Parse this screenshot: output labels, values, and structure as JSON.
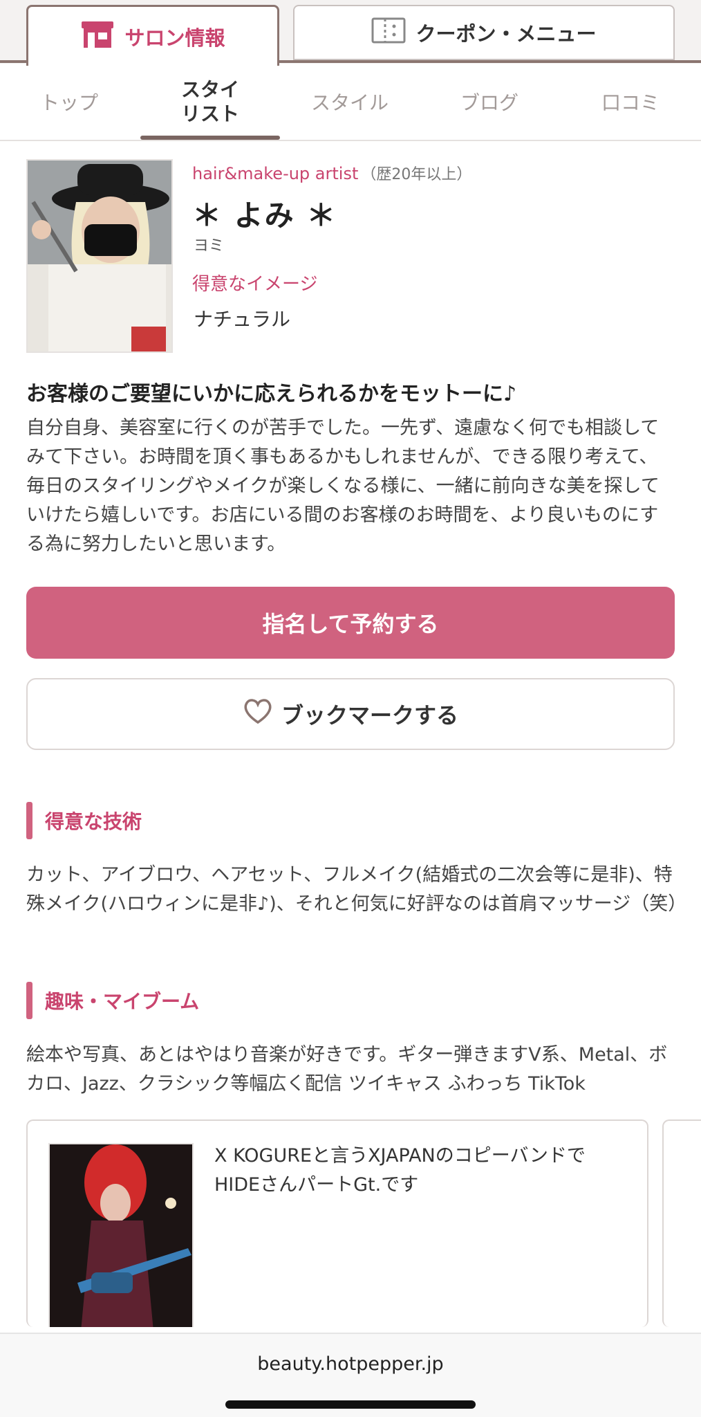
{
  "main_tabs": {
    "salon": "サロン情報",
    "coupon": "クーポン・メニュー"
  },
  "subnav": {
    "top": "トップ",
    "stylist_line1": "スタイ",
    "stylist_line2": "リスト",
    "style": "スタイル",
    "blog": "ブログ",
    "reviews": "口コミ"
  },
  "profile": {
    "role": "hair&make-up artist",
    "experience": "（歴20年以上）",
    "name": "＊ よみ ＊",
    "kana": "ヨミ",
    "image_label": "得意なイメージ",
    "image_value": "ナチュラル"
  },
  "motto": "お客様のご要望にいかに応えられるかをモットーに♪",
  "intro": "自分自身、美容室に行くのが苦手でした。一先ず、遠慮なく何でも相談してみて下さい。お時間を頂く事もあるかもしれませんが、できる限り考えて、毎日のスタイリングやメイクが楽しくなる様に、一緒に前向きな美を探していけたら嬉しいです。お店にいる間のお客様のお時間を、より良いものにする為に努力したいと思います。",
  "buttons": {
    "reserve": "指名して予約する",
    "bookmark": "ブックマークする"
  },
  "skills": {
    "heading": "得意な技術",
    "text": "カット、アイブロウ、ヘアセット、フルメイク(結婚式の二次会等に是非)、特殊メイク(ハロウィンに是非♪)、それと何気に好評なのは首肩マッサージ（笑）"
  },
  "hobby": {
    "heading": "趣味・マイブーム",
    "text": "絵本や写真、あとはやはり音楽が好きです。ギター弾きますV系、Metal、ボカロ、Jazz、クラシック等幅広く配信 ツイキャス ふわっち TikTok"
  },
  "card": {
    "text": "X KOGUREと言うXJAPANのコピーバンドでHIDEさんパートGt.です"
  },
  "browser": {
    "url": "beauty.hotpepper.jp"
  },
  "colors": {
    "accent": "#c9446e",
    "button": "#d0627f",
    "tab_border": "#8b7570"
  }
}
